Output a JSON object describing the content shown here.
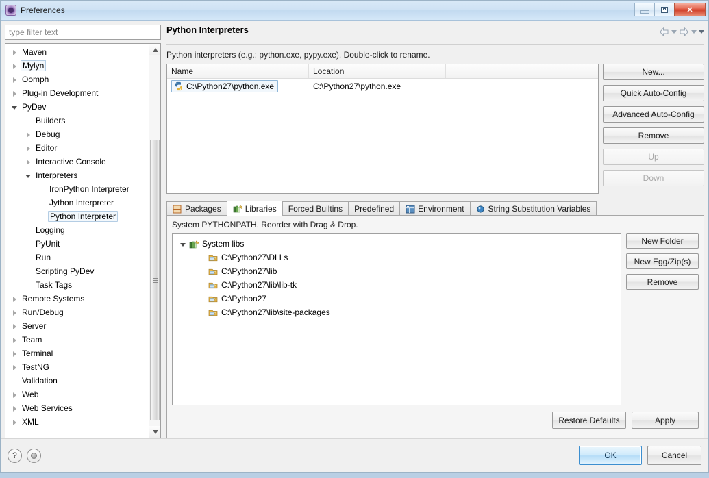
{
  "window": {
    "title": "Preferences",
    "icon": "preferences-gear-icon",
    "controls": {
      "minimize": "Minimize",
      "maximize": "Maximize",
      "close": "Close"
    }
  },
  "sidebar": {
    "filter_placeholder": "type filter text",
    "filter_value": "",
    "items": [
      {
        "label": "Maven",
        "indent": 0,
        "state": "collapsed"
      },
      {
        "label": "Mylyn",
        "indent": 0,
        "state": "collapsed",
        "focused": true
      },
      {
        "label": "Oomph",
        "indent": 0,
        "state": "collapsed"
      },
      {
        "label": "Plug-in Development",
        "indent": 0,
        "state": "collapsed"
      },
      {
        "label": "PyDev",
        "indent": 0,
        "state": "expanded"
      },
      {
        "label": "Builders",
        "indent": 1,
        "state": "leaf"
      },
      {
        "label": "Debug",
        "indent": 1,
        "state": "collapsed"
      },
      {
        "label": "Editor",
        "indent": 1,
        "state": "collapsed"
      },
      {
        "label": "Interactive Console",
        "indent": 1,
        "state": "collapsed"
      },
      {
        "label": "Interpreters",
        "indent": 1,
        "state": "expanded"
      },
      {
        "label": "IronPython Interpreter",
        "indent": 2,
        "state": "leaf"
      },
      {
        "label": "Jython Interpreter",
        "indent": 2,
        "state": "leaf"
      },
      {
        "label": "Python Interpreter",
        "indent": 2,
        "state": "leaf",
        "selected": true
      },
      {
        "label": "Logging",
        "indent": 1,
        "state": "leaf"
      },
      {
        "label": "PyUnit",
        "indent": 1,
        "state": "leaf"
      },
      {
        "label": "Run",
        "indent": 1,
        "state": "leaf"
      },
      {
        "label": "Scripting PyDev",
        "indent": 1,
        "state": "leaf"
      },
      {
        "label": "Task Tags",
        "indent": 1,
        "state": "leaf"
      },
      {
        "label": "Remote Systems",
        "indent": 0,
        "state": "collapsed"
      },
      {
        "label": "Run/Debug",
        "indent": 0,
        "state": "collapsed"
      },
      {
        "label": "Server",
        "indent": 0,
        "state": "collapsed"
      },
      {
        "label": "Team",
        "indent": 0,
        "state": "collapsed"
      },
      {
        "label": "Terminal",
        "indent": 0,
        "state": "collapsed"
      },
      {
        "label": "TestNG",
        "indent": 0,
        "state": "collapsed"
      },
      {
        "label": "Validation",
        "indent": 0,
        "state": "leaf"
      },
      {
        "label": "Web",
        "indent": 0,
        "state": "collapsed"
      },
      {
        "label": "Web Services",
        "indent": 0,
        "state": "collapsed"
      },
      {
        "label": "XML",
        "indent": 0,
        "state": "collapsed"
      }
    ]
  },
  "page": {
    "title": "Python Interpreters",
    "description": "Python interpreters (e.g.: python.exe, pypy.exe).  Double-click to rename.",
    "nav": {
      "back": "back-arrow-icon",
      "back_menu": "back-history-dropdown-icon",
      "forward": "forward-arrow-icon",
      "forward_menu": "forward-history-dropdown-icon",
      "view_menu": "view-menu-icon"
    }
  },
  "interpreter_table": {
    "columns": [
      "Name",
      "Location",
      ""
    ],
    "rows": [
      {
        "name": "C:\\Python27\\python.exe",
        "location": "C:\\Python27\\python.exe",
        "icon": "python-file-icon",
        "selected": true
      }
    ]
  },
  "interpreter_buttons": [
    {
      "label": "New...",
      "enabled": true
    },
    {
      "label": "Quick Auto-Config",
      "enabled": true
    },
    {
      "label": "Advanced Auto-Config",
      "enabled": true
    },
    {
      "label": "Remove",
      "enabled": true
    },
    {
      "label": "Up",
      "enabled": false
    },
    {
      "label": "Down",
      "enabled": false
    }
  ],
  "tabs": [
    {
      "label": "Packages",
      "icon": "packages-grid-icon",
      "active": false
    },
    {
      "label": "Libraries",
      "icon": "libraries-books-icon",
      "active": true
    },
    {
      "label": "Forced Builtins",
      "icon": null,
      "active": false
    },
    {
      "label": "Predefined",
      "icon": null,
      "active": false
    },
    {
      "label": "Environment",
      "icon": "environment-table-icon",
      "active": false
    },
    {
      "label": "String Substitution Variables",
      "icon": "variable-dot-icon",
      "active": false
    }
  ],
  "libraries": {
    "hint": "System PYTHONPATH.   Reorder with Drag & Drop.",
    "root": {
      "label": "System libs",
      "icon": "books-icon",
      "state": "expanded"
    },
    "entries": [
      {
        "label": "C:\\Python27\\DLLs",
        "icon": "folder-jar-icon"
      },
      {
        "label": "C:\\Python27\\lib",
        "icon": "folder-jar-icon"
      },
      {
        "label": "C:\\Python27\\lib\\lib-tk",
        "icon": "folder-jar-icon"
      },
      {
        "label": "C:\\Python27",
        "icon": "folder-jar-icon"
      },
      {
        "label": "C:\\Python27\\lib\\site-packages",
        "icon": "folder-jar-icon"
      }
    ],
    "buttons": [
      {
        "label": "New Folder",
        "enabled": true
      },
      {
        "label": "New Egg/Zip(s)",
        "enabled": true
      },
      {
        "label": "Remove",
        "enabled": true
      }
    ]
  },
  "page_buttons": [
    {
      "label": "Restore Defaults",
      "enabled": true
    },
    {
      "label": "Apply",
      "enabled": true
    }
  ],
  "footer": {
    "help_icon": "help-question-icon",
    "pin_icon": "pin-circle-icon",
    "ok_label": "OK",
    "cancel_label": "Cancel"
  },
  "colors": {
    "accent": "#3c8fd0",
    "titlebar": "#cfe2f4",
    "close_button": "#cf3e28",
    "selection_border": "#8fb6d8"
  }
}
